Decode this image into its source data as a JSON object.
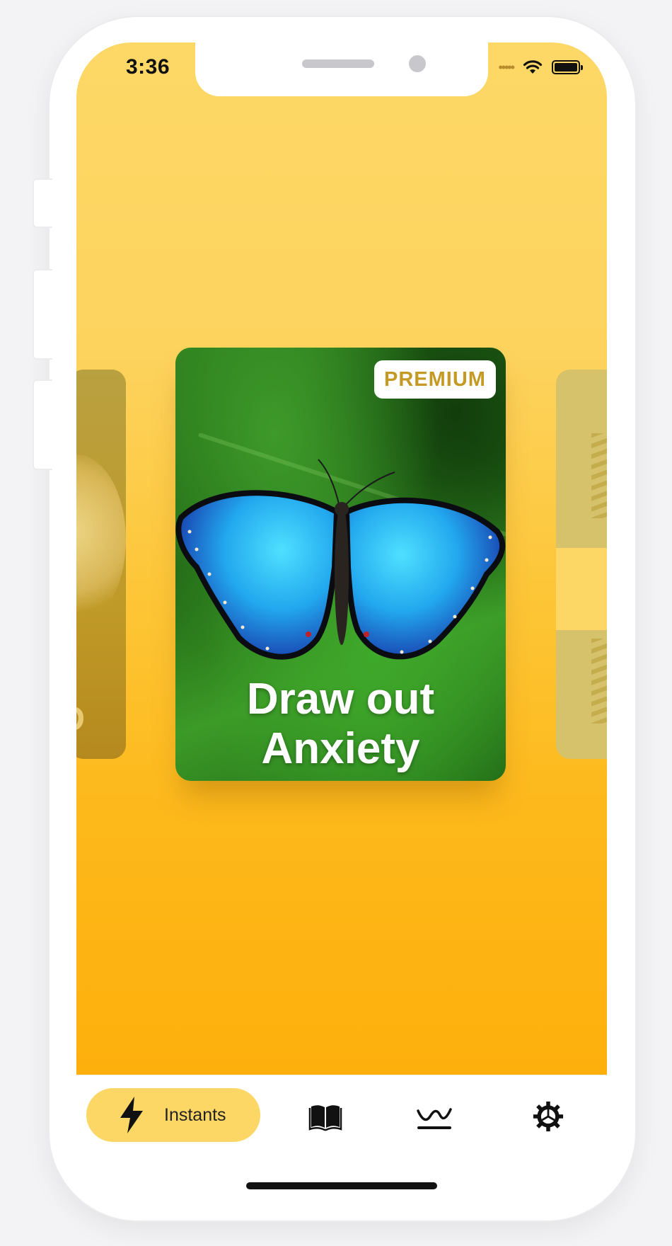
{
  "status_bar": {
    "time": "3:36"
  },
  "card": {
    "badge": "PREMIUM",
    "title_line1": "Draw out",
    "title_line2": "Anxiety"
  },
  "left_card": {
    "partial_text": "D"
  },
  "tabbar": {
    "items": [
      {
        "name": "instants",
        "label": "Instants",
        "icon": "lightning-icon",
        "active": true
      },
      {
        "name": "library",
        "icon": "book-icon",
        "active": false
      },
      {
        "name": "mood",
        "icon": "wave-icon",
        "active": false
      },
      {
        "name": "settings",
        "icon": "gear-icon",
        "active": false
      }
    ],
    "active_color": "#fdd765"
  },
  "colors": {
    "background_top": "#fdd866",
    "background_bottom": "#fdb00c",
    "premium_text": "#c49a25"
  }
}
